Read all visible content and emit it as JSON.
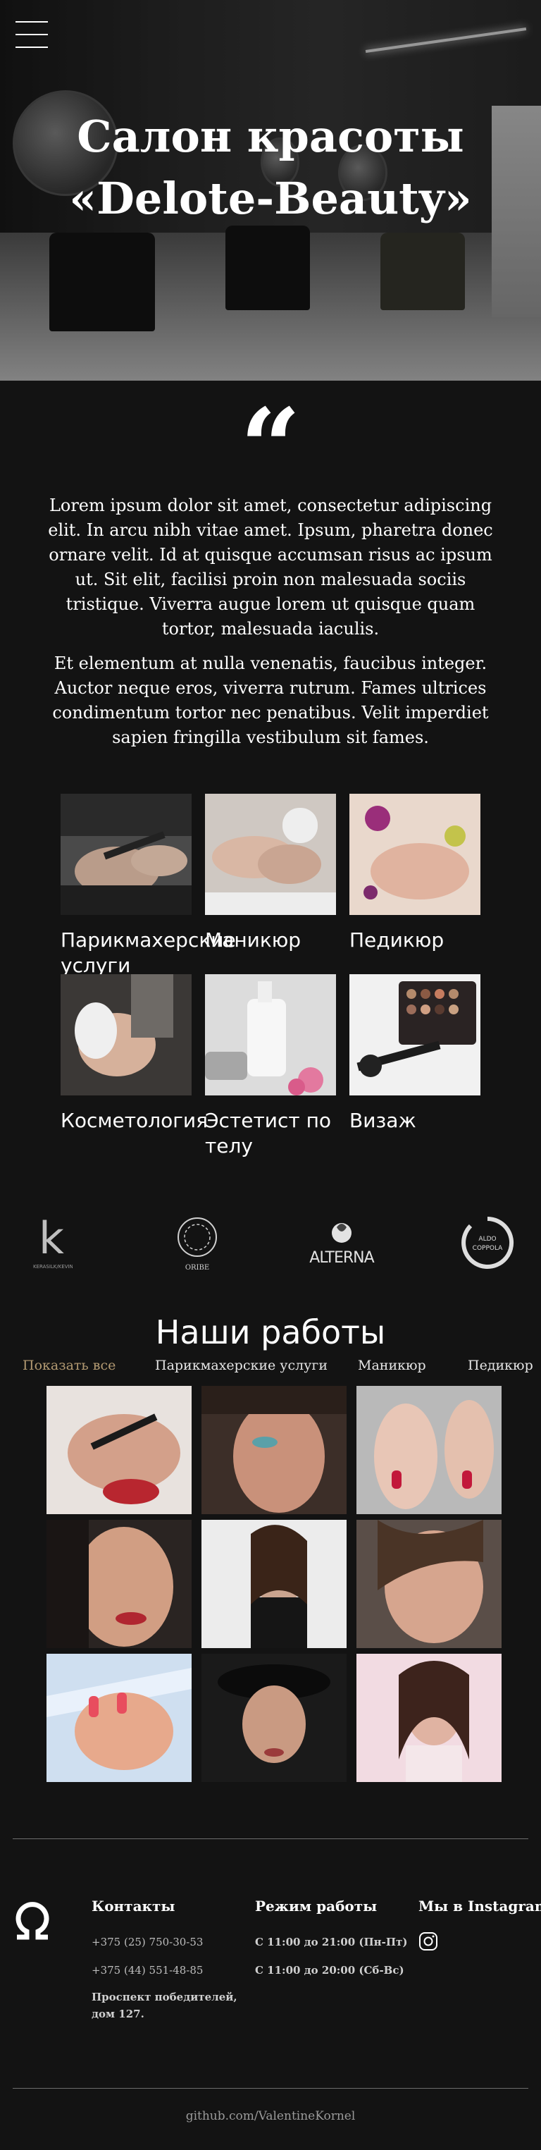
{
  "hero": {
    "title_line1": "Салон красоты",
    "title_line2": "«Delote-Beauty»"
  },
  "nav": {
    "menu_icon": "hamburger-menu-icon"
  },
  "quote": {
    "mark": "“",
    "paragraph1": "Lorem ipsum dolor sit amet, consectetur adipiscing elit. In arcu nibh vitae amet. Ipsum, pharetra donec ornare velit. Id at quisque accumsan risus ac ipsum ut. Sit elit, facilisi proin non malesuada sociis tristique. Viverra augue lorem ut quisque quam tortor, malesuada iaculis.",
    "paragraph2": "Et elementum at nulla venenatis, faucibus integer. Auctor neque eros, viverra rutrum. Fames ultrices condimentum tortor nec penatibus. Velit imperdiet sapien fringilla vestibulum sit fames."
  },
  "services": [
    {
      "label": "Парикмахерские услуги"
    },
    {
      "label": "Маникюр"
    },
    {
      "label": "Педикюр"
    },
    {
      "label": "Косметология"
    },
    {
      "label": "Эстетист по телу"
    },
    {
      "label": "Визаж"
    }
  ],
  "brands": [
    {
      "name": "K",
      "caption": "KERASILK/KEVIN"
    },
    {
      "name": "ORIBE"
    },
    {
      "name": "ALTERNA"
    },
    {
      "name": "ALDO COPPOLA"
    }
  ],
  "works": {
    "title": "Наши работы",
    "filters": [
      "Показать все",
      "Парикмахерские услуги",
      "Маникюр",
      "Педикюр"
    ],
    "active_filter": "Показать все"
  },
  "footer": {
    "contacts_title": "Контакты",
    "phone1": "+375 (25) 750-30-53",
    "phone2": "+375 (44) 551-48-85",
    "address": "Проспект победителей,",
    "address2": "дом 127.",
    "hours_title": "Режим работы",
    "hours1": "С 11:00 до 21:00 (Пн-Пт)",
    "hours2": "С 11:00 до 20:00 (Сб-Вс)",
    "instagram_title": "Мы в Instagram",
    "copyright": "github.com/ValentineKornel"
  },
  "colors": {
    "background": "#131313",
    "accent": "#b39a72",
    "text": "#ffffff"
  }
}
